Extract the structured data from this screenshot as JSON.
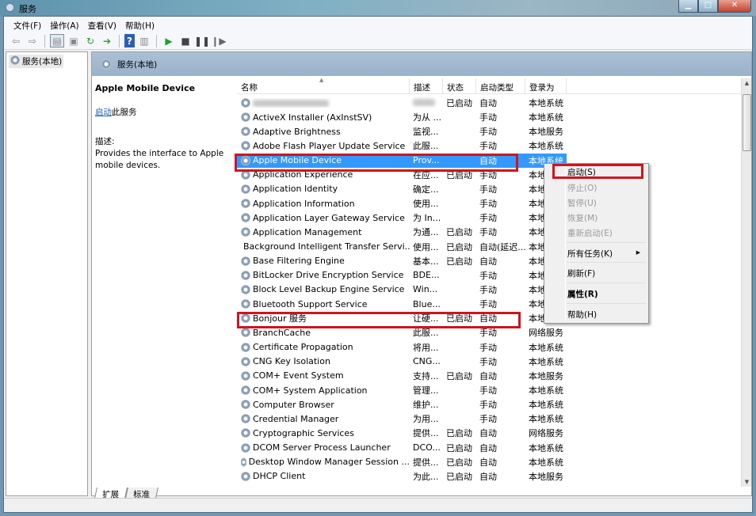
{
  "window": {
    "title": "服务"
  },
  "menu": [
    "文件(F)",
    "操作(A)",
    "查看(V)",
    "帮助(H)"
  ],
  "toolbar": [
    "back-icon",
    "forward-icon",
    "show-hide-tree-icon",
    "properties-icon",
    "refresh-icon",
    "export-icon",
    "help-icon",
    "action-pane-icon",
    "start-icon",
    "stop-icon",
    "pause-icon",
    "resume-icon"
  ],
  "tree": {
    "node": "服务(本地)"
  },
  "pane": {
    "header": "服务(本地)"
  },
  "detail": {
    "title": "Apple Mobile Device",
    "start_link": "启动",
    "start_suffix": "此服务",
    "desc_label": "描述:",
    "desc": "Provides the interface to Apple mobile devices."
  },
  "columns": [
    "名称",
    "描述",
    "状态",
    "启动类型",
    "登录为"
  ],
  "rows": [
    {
      "name": "",
      "desc": "",
      "status": "已启动",
      "startup": "自动",
      "logon": "本地系统",
      "blurred": true
    },
    {
      "name": "ActiveX Installer (AxInstSV)",
      "desc": "为从 ...",
      "status": "",
      "startup": "手动",
      "logon": "本地系统"
    },
    {
      "name": "Adaptive Brightness",
      "desc": "监视...",
      "status": "",
      "startup": "手动",
      "logon": "本地服务"
    },
    {
      "name": "Adobe Flash Player Update Service",
      "desc": "此服...",
      "status": "",
      "startup": "手动",
      "logon": "本地系统"
    },
    {
      "name": "Apple Mobile Device",
      "desc": "Prov...",
      "status": "",
      "startup": "自动",
      "logon": "本地系统",
      "selected": true
    },
    {
      "name": "Application Experience",
      "desc": "在应...",
      "status": "已启动",
      "startup": "手动",
      "logon": "本地系统"
    },
    {
      "name": "Application Identity",
      "desc": "确定...",
      "status": "",
      "startup": "手动",
      "logon": "本地服务"
    },
    {
      "name": "Application Information",
      "desc": "使用...",
      "status": "",
      "startup": "手动",
      "logon": "本地系统"
    },
    {
      "name": "Application Layer Gateway Service",
      "desc": "为 In...",
      "status": "",
      "startup": "手动",
      "logon": "本地服务"
    },
    {
      "name": "Application Management",
      "desc": "为通...",
      "status": "已启动",
      "startup": "手动",
      "logon": "本地系统"
    },
    {
      "name": "Background Intelligent Transfer Servi...",
      "desc": "使用...",
      "status": "已启动",
      "startup": "自动(延迟...",
      "logon": "本地系统"
    },
    {
      "name": "Base Filtering Engine",
      "desc": "基本...",
      "status": "已启动",
      "startup": "自动",
      "logon": "本地服务"
    },
    {
      "name": "BitLocker Drive Encryption Service",
      "desc": "BDE...",
      "status": "",
      "startup": "手动",
      "logon": "本地系统"
    },
    {
      "name": "Block Level Backup Engine Service",
      "desc": "Win...",
      "status": "",
      "startup": "手动",
      "logon": "本地系统"
    },
    {
      "name": "Bluetooth Support Service",
      "desc": "Blue...",
      "status": "",
      "startup": "手动",
      "logon": "本地服务"
    },
    {
      "name": "Bonjour 服务",
      "desc": "让硬...",
      "status": "已启动",
      "startup": "自动",
      "logon": "本地系统"
    },
    {
      "name": "BranchCache",
      "desc": "此服...",
      "status": "",
      "startup": "手动",
      "logon": "网络服务"
    },
    {
      "name": "Certificate Propagation",
      "desc": "将用...",
      "status": "",
      "startup": "手动",
      "logon": "本地系统"
    },
    {
      "name": "CNG Key Isolation",
      "desc": "CNG...",
      "status": "",
      "startup": "手动",
      "logon": "本地系统"
    },
    {
      "name": "COM+ Event System",
      "desc": "支持...",
      "status": "已启动",
      "startup": "自动",
      "logon": "本地服务"
    },
    {
      "name": "COM+ System Application",
      "desc": "管理...",
      "status": "",
      "startup": "手动",
      "logon": "本地系统"
    },
    {
      "name": "Computer Browser",
      "desc": "维护...",
      "status": "",
      "startup": "手动",
      "logon": "本地系统"
    },
    {
      "name": "Credential Manager",
      "desc": "为用...",
      "status": "",
      "startup": "手动",
      "logon": "本地系统"
    },
    {
      "name": "Cryptographic Services",
      "desc": "提供...",
      "status": "已启动",
      "startup": "自动",
      "logon": "网络服务"
    },
    {
      "name": "DCOM Server Process Launcher",
      "desc": "DCO...",
      "status": "已启动",
      "startup": "自动",
      "logon": "本地系统"
    },
    {
      "name": "Desktop Window Manager Session ...",
      "desc": "提供...",
      "status": "已启动",
      "startup": "自动",
      "logon": "本地系统"
    },
    {
      "name": "DHCP Client",
      "desc": "为此...",
      "status": "已启动",
      "startup": "自动",
      "logon": "本地服务"
    }
  ],
  "context_menu": [
    {
      "label": "启动(S)",
      "disabled": false
    },
    {
      "label": "停止(O)",
      "disabled": true
    },
    {
      "label": "暂停(U)",
      "disabled": true
    },
    {
      "label": "恢复(M)",
      "disabled": true
    },
    {
      "label": "重新启动(E)",
      "disabled": true
    },
    {
      "label": "所有任务(K)",
      "submenu": true
    },
    {
      "label": "刷新(F)"
    },
    {
      "label": "属性(R)",
      "bold": true
    },
    {
      "label": "帮助(H)"
    }
  ],
  "tabs": [
    "扩展",
    "标准"
  ],
  "colors": {
    "selection": "#3399ff",
    "highlight_box": "#d0141e"
  }
}
